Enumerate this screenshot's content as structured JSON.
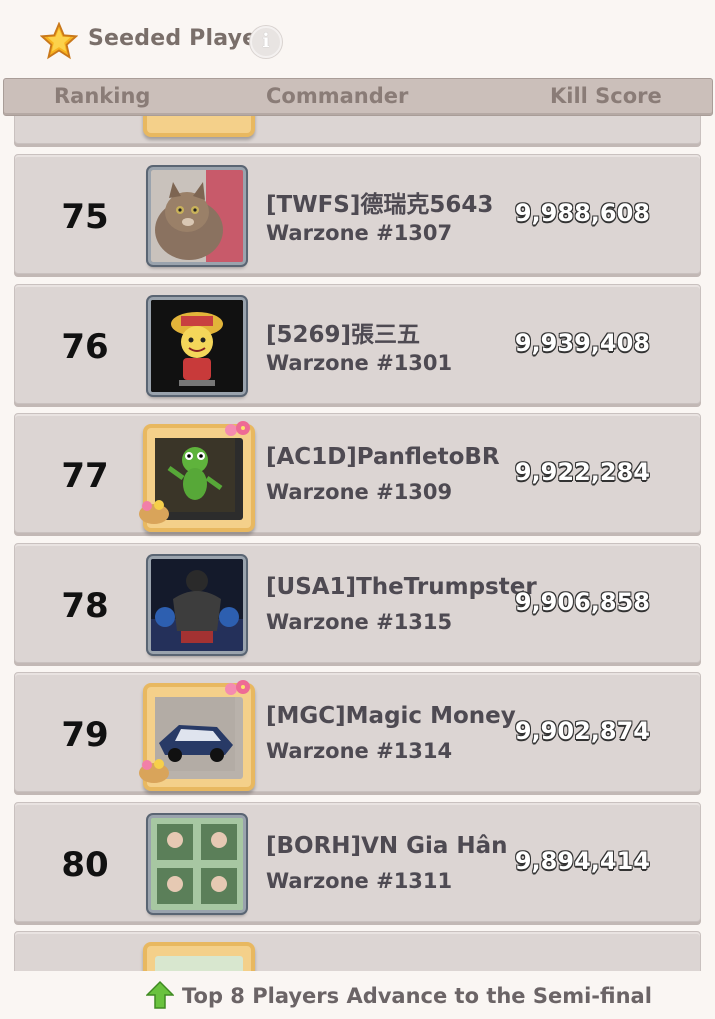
{
  "header": {
    "title": "Seeded Player",
    "info_glyph": "i",
    "icons": {
      "title": "star-icon",
      "info": "info-icon"
    }
  },
  "columns": {
    "ranking": "Ranking",
    "commander": "Commander",
    "kill_score": "Kill Score"
  },
  "rows": [
    {
      "rank": "75",
      "name": "[TWFS]德瑞克5643",
      "warzone": "Warzone #1307",
      "score": "9,988,608",
      "avatar": "cat-avatar"
    },
    {
      "rank": "76",
      "name": "[5269]張三五",
      "warzone": "Warzone #1301",
      "score": "9,939,408",
      "avatar": "cartoon-avatar"
    },
    {
      "rank": "77",
      "name": "[AC1D]PanfletoBR",
      "warzone": "Warzone #1309",
      "score": "9,922,284",
      "avatar": "frog-avatar"
    },
    {
      "rank": "78",
      "name": "[USA1]TheTrumpster",
      "warzone": "Warzone #1315",
      "score": "9,906,858",
      "avatar": "boxer-avatar"
    },
    {
      "rank": "79",
      "name": "[MGC]Magic Money",
      "warzone": "Warzone #1314",
      "score": "9,902,874",
      "avatar": "car-avatar"
    },
    {
      "rank": "80",
      "name": "[BORH]ᐯN Gia Hân",
      "warzone": "Warzone #1311",
      "score": "9,894,414",
      "avatar": "photo-avatar"
    }
  ],
  "footer": {
    "text": "Top 8 Players Advance to the Semi-final",
    "icon": "up-arrow-icon"
  },
  "colors": {
    "background": "#faf6f3",
    "row": "#dcd5d3",
    "header_bar": "#cbbfba",
    "text": "#4e4a52"
  }
}
